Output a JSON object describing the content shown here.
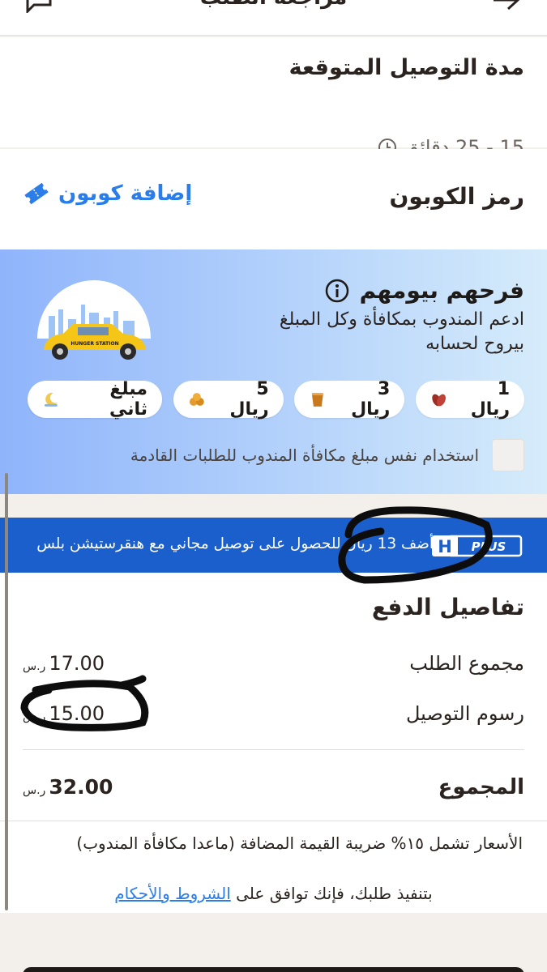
{
  "header": {
    "title": "مراجعة الطلب"
  },
  "delivery": {
    "heading": "مدة التوصيل المتوقعة",
    "time": "15 - 25 دقائق"
  },
  "coupon": {
    "heading": "رمز الكوبون",
    "add_label": "إضافة كوبون"
  },
  "tip": {
    "heading": "فرحهم بيومهم",
    "line1": "ادعم المندوب بمكافأة وكل المبلغ",
    "line2": "بيروح لحسابه",
    "illustration_text": "HUNGER STATION",
    "chips": [
      {
        "label": "1 ريال",
        "icon": "dates-icon"
      },
      {
        "label": "3 ريال",
        "icon": "tea-cup-icon"
      },
      {
        "label": "5 ريال",
        "icon": "pastry-icon"
      },
      {
        "label": "مبلغ ثاني",
        "icon": "crescent-icon"
      }
    ],
    "reuse_label": "استخدام نفس مبلغ مكافأة المندوب للطلبات القادمة"
  },
  "plus_banner": {
    "text": "أضف 13 ريال للحصول على توصيل مجاني مع هنقرستيشن بلس",
    "badge_letter": "H",
    "badge_word": "PLUS"
  },
  "payment": {
    "heading": "تفاصيل الدفع",
    "currency": "ر.س",
    "subtotal_label": "مجموع الطلب",
    "subtotal_value": "17.00",
    "delivery_label": "رسوم التوصيل",
    "delivery_value": "15.00",
    "total_label": "المجموع",
    "total_value": "32.00",
    "vat_note": "الأسعار تشمل ١٥% ضريبة القيمة المضافة (ماعدا مكافأة المندوب)",
    "terms_prefix": "بتنفيذ طلبك، فإنك توافق على ",
    "terms_link": "الشروط والأحكام"
  },
  "colors": {
    "accent_blue": "#2b7de9",
    "banner_blue": "#1a5fcc",
    "background": "#f3efeb"
  }
}
